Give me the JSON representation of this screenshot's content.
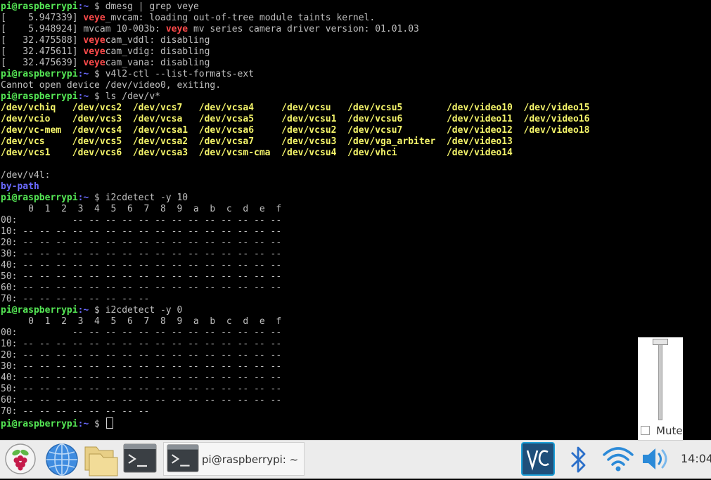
{
  "terminal": {
    "prompt_user": "pi@raspberrypi",
    "prompt_path": ":~ $",
    "lines": [
      [
        [
          "p",
          "pi@raspberrypi"
        ],
        [
          "b",
          ":~"
        ],
        [
          "n",
          " $ dmesg | grep veye"
        ]
      ],
      [
        [
          "n",
          "[    5.947339] "
        ],
        [
          "r",
          "veye"
        ],
        [
          "n",
          "_mvcam: loading out-of-tree module taints kernel."
        ]
      ],
      [
        [
          "n",
          "[    5.948924] mvcam 10-003b: "
        ],
        [
          "r",
          "veye"
        ],
        [
          "n",
          " mv series camera driver version: 01.01.03"
        ]
      ],
      [
        [
          "n",
          "[   32.475588] "
        ],
        [
          "r",
          "veye"
        ],
        [
          "n",
          "cam_vddl: disabling"
        ]
      ],
      [
        [
          "n",
          "[   32.475611] "
        ],
        [
          "r",
          "veye"
        ],
        [
          "n",
          "cam_vdig: disabling"
        ]
      ],
      [
        [
          "n",
          "[   32.475639] "
        ],
        [
          "r",
          "veye"
        ],
        [
          "n",
          "cam_vana: disabling"
        ]
      ],
      [
        [
          "p",
          "pi@raspberrypi"
        ],
        [
          "b",
          ":~"
        ],
        [
          "n",
          " $ v4l2-ctl --list-formats-ext"
        ]
      ],
      [
        [
          "n",
          "Cannot open device /dev/video0, exiting."
        ]
      ],
      [
        [
          "p",
          "pi@raspberrypi"
        ],
        [
          "b",
          ":~"
        ],
        [
          "n",
          " $ ls /dev/v*"
        ]
      ],
      [
        [
          "y",
          "/dev/vchiq   /dev/vcs2  /dev/vcs7   /dev/vcsa4     /dev/vcsu   /dev/vcsu5        /dev/video10  /dev/video15"
        ]
      ],
      [
        [
          "y",
          "/dev/vcio    /dev/vcs3  /dev/vcsa   /dev/vcsa5     /dev/vcsu1  /dev/vcsu6        /dev/video11  /dev/video16"
        ]
      ],
      [
        [
          "y",
          "/dev/vc-mem  /dev/vcs4  /dev/vcsa1  /dev/vcsa6     /dev/vcsu2  /dev/vcsu7        /dev/video12  /dev/video18"
        ]
      ],
      [
        [
          "y",
          "/dev/vcs     /dev/vcs5  /dev/vcsa2  /dev/vcsa7     /dev/vcsu3  /dev/vga_arbiter  /dev/video13"
        ]
      ],
      [
        [
          "y",
          "/dev/vcs1    /dev/vcs6  /dev/vcsa3  /dev/vcsm-cma  /dev/vcsu4  /dev/vhci         /dev/video14"
        ]
      ],
      [
        [
          "n",
          ""
        ]
      ],
      [
        [
          "n",
          "/dev/v4l:"
        ]
      ],
      [
        [
          "b",
          "by-path"
        ]
      ],
      [
        [
          "p",
          "pi@raspberrypi"
        ],
        [
          "b",
          ":~"
        ],
        [
          "n",
          " $ i2cdetect -y 10"
        ]
      ],
      [
        [
          "n",
          "     0  1  2  3  4  5  6  7  8  9  a  b  c  d  e  f"
        ]
      ],
      [
        [
          "n",
          "00:          -- -- -- -- -- -- -- -- -- -- -- -- --"
        ]
      ],
      [
        [
          "n",
          "10: -- -- -- -- -- -- -- -- -- -- -- -- -- -- -- --"
        ]
      ],
      [
        [
          "n",
          "20: -- -- -- -- -- -- -- -- -- -- -- -- -- -- -- --"
        ]
      ],
      [
        [
          "n",
          "30: -- -- -- -- -- -- -- -- -- -- -- -- -- -- -- --"
        ]
      ],
      [
        [
          "n",
          "40: -- -- -- -- -- -- -- -- -- -- -- -- -- -- -- --"
        ]
      ],
      [
        [
          "n",
          "50: -- -- -- -- -- -- -- -- -- -- -- -- -- -- -- --"
        ]
      ],
      [
        [
          "n",
          "60: -- -- -- -- -- -- -- -- -- -- -- -- -- -- -- --"
        ]
      ],
      [
        [
          "n",
          "70: -- -- -- -- -- -- -- --"
        ]
      ],
      [
        [
          "p",
          "pi@raspberrypi"
        ],
        [
          "b",
          ":~"
        ],
        [
          "n",
          " $ i2cdetect -y 0"
        ]
      ],
      [
        [
          "n",
          "     0  1  2  3  4  5  6  7  8  9  a  b  c  d  e  f"
        ]
      ],
      [
        [
          "n",
          "00:          -- -- -- -- -- -- -- -- -- -- -- -- --"
        ]
      ],
      [
        [
          "n",
          "10: -- -- -- -- -- -- -- -- -- -- -- -- -- -- -- --"
        ]
      ],
      [
        [
          "n",
          "20: -- -- -- -- -- -- -- -- -- -- -- -- -- -- -- --"
        ]
      ],
      [
        [
          "n",
          "30: -- -- -- -- -- -- -- -- -- -- -- -- -- -- -- --"
        ]
      ],
      [
        [
          "n",
          "40: -- -- -- -- -- -- -- -- -- -- -- -- -- -- -- --"
        ]
      ],
      [
        [
          "n",
          "50: -- -- -- -- -- -- -- -- -- -- -- -- -- -- -- --"
        ]
      ],
      [
        [
          "n",
          "60: -- -- -- -- -- -- -- -- -- -- -- -- -- -- -- --"
        ]
      ],
      [
        [
          "n",
          "70: -- -- -- -- -- -- -- --"
        ]
      ],
      [
        [
          "p",
          "pi@raspberrypi"
        ],
        [
          "b",
          ":~"
        ],
        [
          "n",
          " $ "
        ],
        [
          "c",
          ""
        ]
      ]
    ]
  },
  "volume_popup": {
    "level_percent": 100,
    "mute_label": "Mute",
    "muted": false
  },
  "taskbar": {
    "window_label": "pi@raspberrypi: ~",
    "clock": "14:04",
    "icons": {
      "menu": "raspberry-menu-icon",
      "browser": "web-browser-icon",
      "files": "file-manager-icon",
      "terminal": "terminal-icon",
      "vnc": "vnc-icon",
      "bluetooth": "bluetooth-icon",
      "wifi": "wifi-icon",
      "volume": "volume-icon"
    }
  },
  "colors": {
    "prompt_user": "#55e855",
    "prompt_path": "#6a6aff",
    "highlight": "#ff4b4b",
    "device_files": "#f4f46a",
    "text": "#bfbfbf"
  }
}
